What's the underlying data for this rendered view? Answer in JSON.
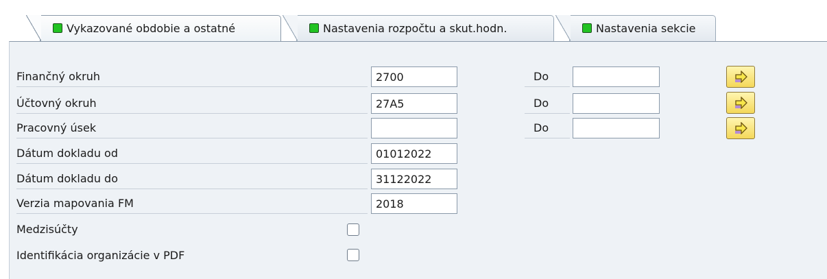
{
  "tabs": [
    {
      "label": "Vykazované obdobie a ostatné",
      "status_color": "#22c322",
      "active": true
    },
    {
      "label": "Nastavenia rozpočtu a skut.hodn.",
      "status_color": "#22c322",
      "active": false
    },
    {
      "label": "Nastavenia sekcie",
      "status_color": "#22c322",
      "active": false
    }
  ],
  "form": {
    "rows": [
      {
        "label": "Finančný okruh",
        "value": "2700",
        "to_label": "Do",
        "to_value": ""
      },
      {
        "label": "Účtovný okruh",
        "value": "27A5",
        "to_label": "Do",
        "to_value": ""
      },
      {
        "label": "Pracovný úsek",
        "value": "",
        "to_label": "Do",
        "to_value": ""
      },
      {
        "label": "Dátum dokladu od",
        "value": "01012022"
      },
      {
        "label": "Dátum dokladu do",
        "value": "31122022"
      },
      {
        "label": "Verzia mapovania FM",
        "value": "2018"
      }
    ],
    "checkboxes": [
      {
        "label": "Medzisúčty",
        "checked": false
      },
      {
        "label": "Identifikácia organizácie v PDF",
        "checked": false
      }
    ],
    "multiple_selection_icon": "arrow-right-icon"
  },
  "colors": {
    "panel_bg": "#eef2f6",
    "status_green": "#22c322",
    "button_yellow": "#f4d85a"
  }
}
